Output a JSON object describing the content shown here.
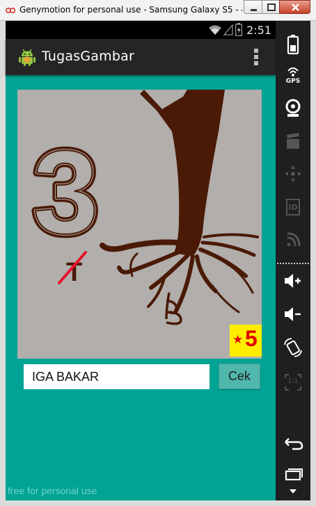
{
  "window": {
    "title": "Genymotion for personal use - Samsung Galaxy S5 - 4.4.4..."
  },
  "status_bar": {
    "time": "2:51"
  },
  "action_bar": {
    "title": "TugasGambar"
  },
  "puzzle": {
    "badge_number": "5",
    "badge_star": "★",
    "image_text": "3",
    "image_letter_crossed": "T",
    "image_letter_root": "B"
  },
  "answer_form": {
    "input_value": "IGA BAKAR",
    "submit_label": "Cek"
  },
  "watermark": "free for personal use",
  "side_toolbar": {
    "gps_label": "GPS",
    "id_label": "ID",
    "multitouch_label": "1:1"
  },
  "colors": {
    "content_bg": "#00a394",
    "action_bar_bg": "#252525",
    "tree_brown": "#4a1a06",
    "badge_yellow": "#ffed00",
    "badge_red": "#e00000"
  }
}
